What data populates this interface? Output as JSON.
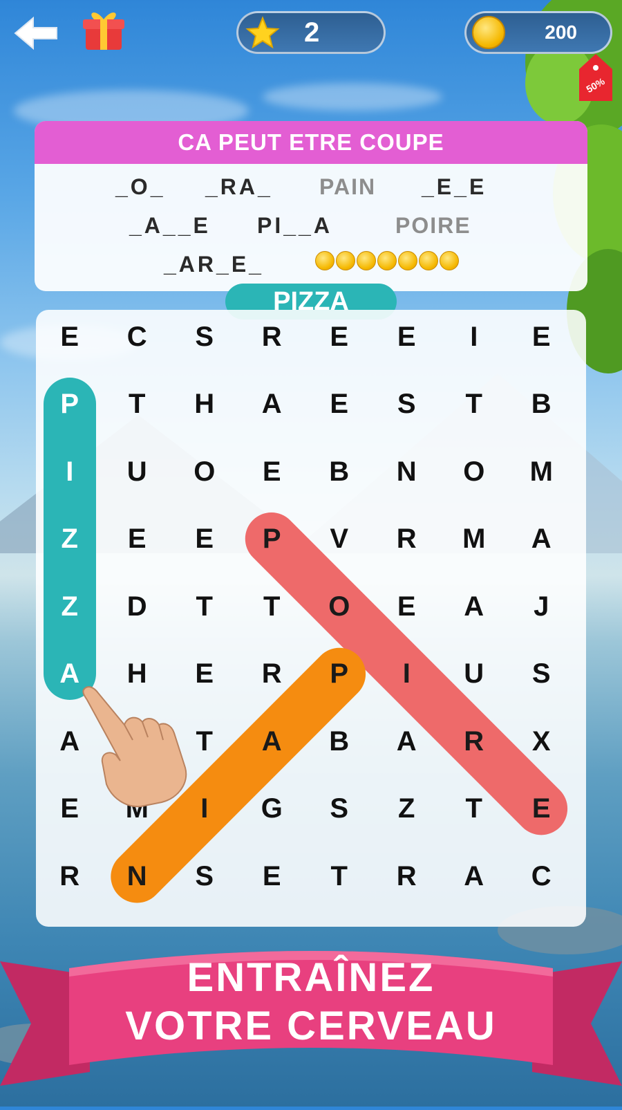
{
  "header": {
    "stars": "2",
    "coins": "200",
    "sale_tag": "50%"
  },
  "clue": {
    "title": "CA PEUT ETRE COUPE",
    "words_row1": [
      "_O_",
      "_RA_",
      "PAIN",
      "_E_E"
    ],
    "words_row2": [
      "_A__E",
      "PI__A",
      "POIRE"
    ],
    "words_row3": [
      "_AR_E_"
    ],
    "hint_coin_count": 7
  },
  "current_word": "PIZZA",
  "grid": {
    "rows": [
      [
        "E",
        "C",
        "S",
        "R",
        "E",
        "E",
        "I",
        "E"
      ],
      [
        "P",
        "T",
        "H",
        "A",
        "E",
        "S",
        "T",
        "B"
      ],
      [
        "I",
        "U",
        "O",
        "E",
        "B",
        "N",
        "O",
        "M"
      ],
      [
        "Z",
        "E",
        "E",
        "P",
        "V",
        "R",
        "M",
        "A"
      ],
      [
        "Z",
        "D",
        "T",
        "T",
        "O",
        "E",
        "A",
        "J"
      ],
      [
        "A",
        "H",
        "E",
        "R",
        "P",
        "I",
        "U",
        "S"
      ],
      [
        "A",
        "",
        "T",
        "A",
        "B",
        "A",
        "R",
        "X"
      ],
      [
        "E",
        "M",
        "I",
        "G",
        "S",
        "Z",
        "T",
        "E"
      ],
      [
        "R",
        "N",
        "S",
        "E",
        "T",
        "R",
        "A",
        "C"
      ]
    ],
    "found_words": [
      {
        "word": "PIZZA",
        "color": "#2bb5b6",
        "from": [
          1,
          0
        ],
        "to": [
          5,
          0
        ]
      },
      {
        "word": "POIRE",
        "color": "#ee6a6a",
        "from": [
          3,
          3
        ],
        "to": [
          7,
          7
        ]
      },
      {
        "word": "PAIN",
        "color": "#f58c10",
        "from": [
          5,
          4
        ],
        "to": [
          8,
          1
        ]
      }
    ]
  },
  "banner": {
    "line1": "ENTRAÎNEZ",
    "line2": "VOTRE CERVEAU",
    "color": "#e8407f"
  },
  "icons": [
    "back-arrow-icon",
    "gift-icon",
    "star-icon",
    "coin-icon",
    "sale-tag-icon",
    "pointing-hand-icon"
  ]
}
